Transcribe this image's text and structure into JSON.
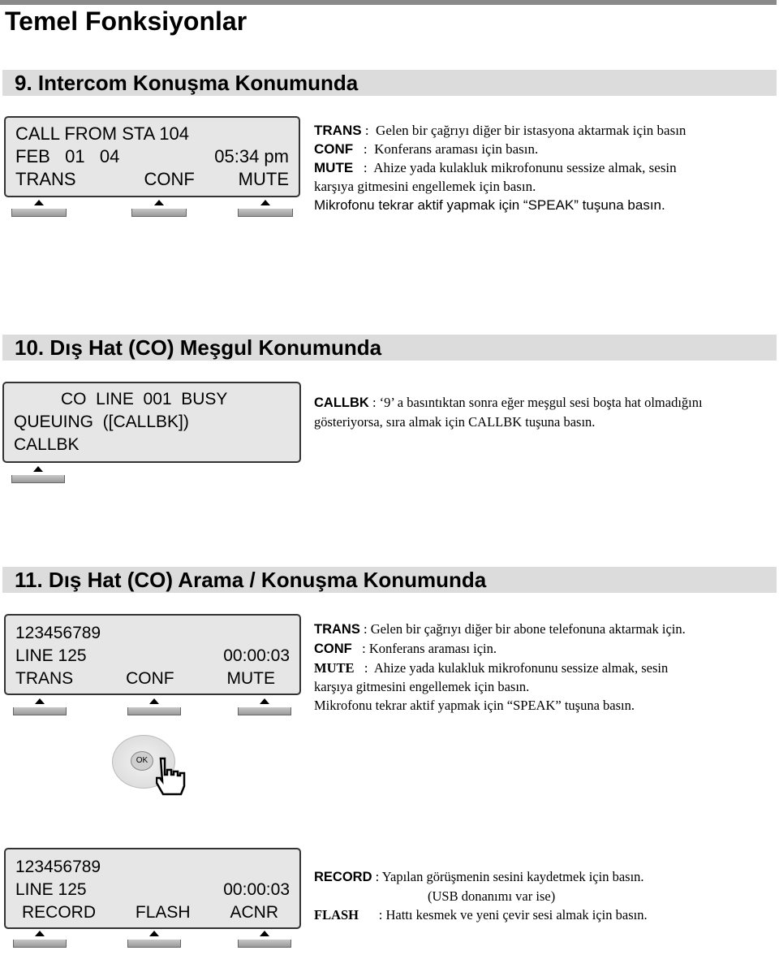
{
  "page": {
    "title": "Temel Fonksiyonlar"
  },
  "sections": [
    {
      "heading": "9. Intercom Konuşma Konumunda",
      "lcd": {
        "line1": "CALL FROM STA 104",
        "line2_left": "FEB   01   04",
        "line2_right": "05:34 pm",
        "softkeys": [
          "TRANS",
          "CONF",
          "MUTE"
        ]
      },
      "descriptions": [
        {
          "key": "TRANS",
          "sep": " :  ",
          "text": "Gelen bir çağrıyı diğer bir istasyona aktarmak için basın"
        },
        {
          "key": "CONF",
          "sep": "   :  ",
          "text": "Konferans araması için basın."
        },
        {
          "key": "MUTE",
          "sep": "   :  ",
          "text": "Ahize yada kulakluk mikrofonunu sessize almak, sesin"
        },
        {
          "text": "karşıya gitmesini engellemek için basın."
        },
        {
          "text": "Mikrofonu tekrar aktif yapmak için “SPEAK” tuşuna basın."
        }
      ]
    },
    {
      "heading": "10. Dış Hat (CO) Meşgul Konumunda",
      "lcd": {
        "line1": "CO  LINE  001  BUSY",
        "line2": "QUEUING  ([CALLBK])",
        "line3": "CALLBK",
        "softkeys": [
          "CALLBK"
        ]
      },
      "descriptions": [
        {
          "key": "CALLBK",
          "sep": " : ",
          "text": "‘9’ a basıntıktan sonra eğer meşgul sesi boşta hat olmadığını"
        },
        {
          "text": "gösteriyorsa, sıra almak için CALLBK tuşuna basın."
        }
      ]
    },
    {
      "heading": "11. Dış Hat (CO) Arama / Konuşma Konumunda",
      "lcd": {
        "line1": "123456789",
        "line2_left": "LINE 125",
        "line2_right": "00:00:03",
        "softkeys": [
          "TRANS",
          "CONF",
          "MUTE"
        ]
      },
      "descriptions": [
        {
          "key": "TRANS",
          "sep": " : ",
          "text": "Gelen bir çağrıyı diğer bir abone telefonuna aktarmak için."
        },
        {
          "key": "CONF",
          "sep": "   : ",
          "text": "Konferans araması için."
        },
        {
          "key": "MUTE",
          "sep": "   :  ",
          "text": "Ahize yada kulakluk mikrofonunu sessize almak, sesin"
        },
        {
          "text": "karşıya gitmesini engellemek için basın."
        },
        {
          "text": "Mikrofonu tekrar aktif yapmak için “SPEAK” tuşuna basın."
        }
      ],
      "navpad": {
        "ok_label": "OK"
      },
      "lcd2": {
        "line1": "123456789",
        "line2_left": "LINE 125",
        "line2_right": "00:00:03",
        "softkeys": [
          "RECORD",
          "FLASH",
          "ACNR"
        ]
      },
      "descriptions2": [
        {
          "key": "RECORD",
          "sep": " : ",
          "text": "Yapılan görüşmenin sesini kaydetmek için basın."
        },
        {
          "text": "(USB  donanımı var ise)"
        },
        {
          "key": "FLASH",
          "sep": "      : ",
          "text": "Hattı kesmek ve yeni çevir sesi almak için basın."
        }
      ]
    }
  ]
}
